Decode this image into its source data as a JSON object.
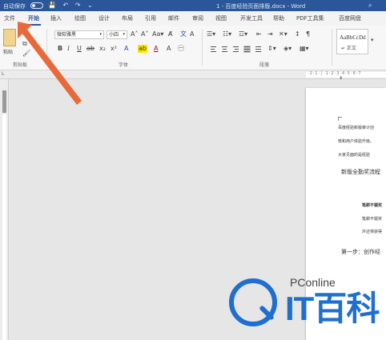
{
  "titlebar": {
    "autosave_label": "自动保存",
    "doc_title": "1 - 百度经验页面排版.docx - Word"
  },
  "tabs": [
    "文件",
    "开始",
    "插入",
    "绘图",
    "设计",
    "布局",
    "引用",
    "邮件",
    "审阅",
    "视图",
    "开发工具",
    "帮助",
    "PDF工具集",
    "百度网盘"
  ],
  "active_tab": "开始",
  "ribbon": {
    "paste_label": "粘贴",
    "font_name": "微软雅黑",
    "font_size": "小四",
    "groups": {
      "clipboard": "剪贴板",
      "font": "字体",
      "paragraph": "段落"
    },
    "style_sample": "AaBbCcDd",
    "style_name": "↵ 正文"
  },
  "document": {
    "lines": [
      "百度经验新版审计创",
      "核和用户体验升级。",
      "大家见面的是经验"
    ],
    "heading": "新版全勤奖流程",
    "bullets": [
      "笔耕不辍奖",
      "笔耕不辍奖",
      "外还将获得"
    ],
    "step": "第一步：创作经"
  },
  "watermark": {
    "sub": "PConline",
    "main": "IT百科"
  },
  "colors": {
    "title_bar": "#2b579a",
    "arrow": "#e8693a",
    "watermark": "#1f6fd1"
  }
}
